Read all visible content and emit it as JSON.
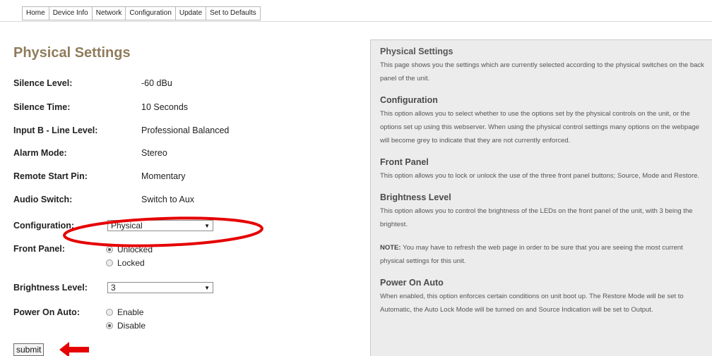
{
  "nav": [
    "Home",
    "Device Info",
    "Network",
    "Configuration",
    "Update",
    "Set to Defaults"
  ],
  "page_title": "Physical Settings",
  "fields": [
    {
      "label": "Silence Level:",
      "value": "-60 dBu"
    },
    {
      "label": "Silence Time:",
      "value": "10 Seconds"
    },
    {
      "label": "Input B - Line Level:",
      "value": "Professional Balanced"
    },
    {
      "label": "Alarm Mode:",
      "value": "Stereo"
    },
    {
      "label": "Remote Start Pin:",
      "value": "Momentary"
    },
    {
      "label": "Audio Switch:",
      "value": "Switch to Aux"
    }
  ],
  "configuration": {
    "label": "Configuration:",
    "selected": "Physical"
  },
  "front_panel": {
    "label": "Front Panel:",
    "options": [
      "Unlocked",
      "Locked"
    ],
    "selected": "Unlocked"
  },
  "brightness": {
    "label": "Brightness Level:",
    "selected": "3"
  },
  "power_on_auto": {
    "label": "Power On Auto:",
    "options": [
      "Enable",
      "Disable"
    ],
    "selected": "Disable"
  },
  "submit_label": "submit",
  "annotation_color": "#e60000",
  "help": {
    "s1": {
      "title": "Physical Settings",
      "text": "This page shows you the settings which are currently selected according to the physical switches on the back panel of the unit."
    },
    "s2": {
      "title": "Configuration",
      "text": "This option allows you to select whether to use the options set by the physical controls on the unit, or the options set up using this webserver. When using the physical control settings many options on the webpage will become grey to indicate that they are not currently enforced."
    },
    "s3": {
      "title": "Front Panel",
      "text": "This option allows you to lock or unlock the use of the three front panel buttons; Source, Mode and Restore."
    },
    "s4": {
      "title": "Brightness Level",
      "text": "This option allows you to control the brightness of the LEDs on the front panel of the unit, with 3 being the brightest."
    },
    "note": {
      "label": "NOTE:",
      "text": " You may have to refresh the web page in order to be sure that you are seeing the most current physical settings for this unit."
    },
    "s5": {
      "title": "Power On Auto",
      "text": "When enabled, this option enforces certain conditions on unit boot up. The Restore Mode will be set to Automatic, the Auto Lock Mode will be turned on and Source Indication will be set to Output."
    }
  }
}
